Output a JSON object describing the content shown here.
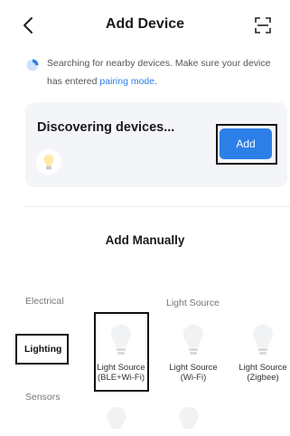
{
  "header": {
    "title": "Add Device",
    "back_icon": "chevron-left-icon",
    "scan_icon": "scan-frame-icon"
  },
  "notice": {
    "text_line1": "Searching for nearby devices. Make sure your device",
    "text_line2_prefix": "has entered ",
    "link_text": "pairing mode",
    "text_line2_suffix": ".",
    "link_color": "#2d7fe8"
  },
  "discover": {
    "title": "Discovering devices...",
    "add_label": "Add",
    "accent": "#2d7fe8"
  },
  "manual": {
    "title": "Add Manually",
    "categories": {
      "electrical": "Electrical",
      "lighting": "Lighting",
      "sensors": "Sensors"
    },
    "group_title": "Light Source",
    "devices": [
      {
        "line1": "Light Source",
        "line2": "(BLE+Wi-Fi)"
      },
      {
        "line1": "Light Source",
        "line2": "(Wi-Fi)"
      },
      {
        "line1": "Light Source",
        "line2": "(Zigbee)"
      }
    ]
  }
}
